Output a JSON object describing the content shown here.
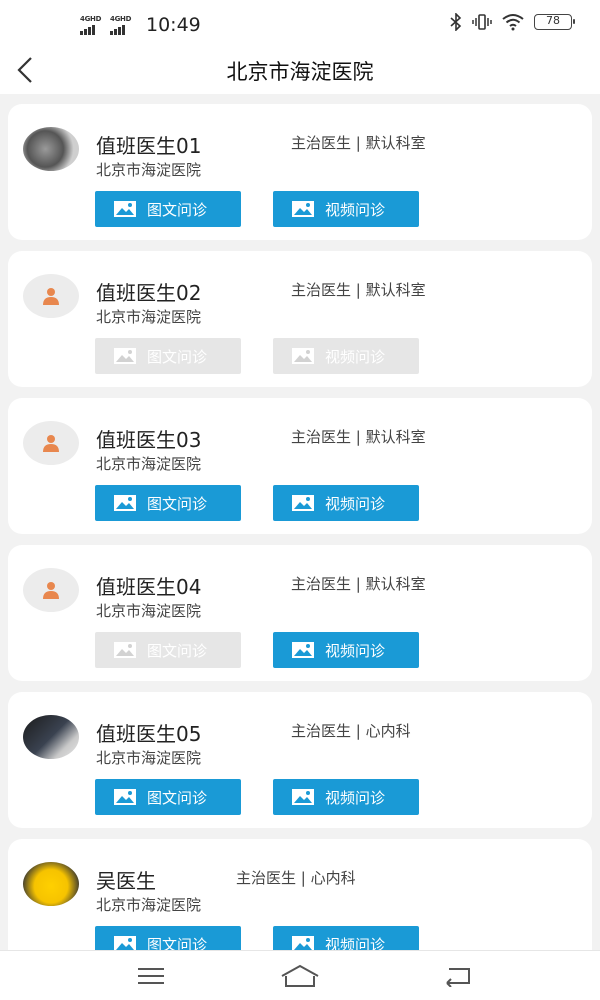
{
  "status_bar": {
    "network_1": "4GHD",
    "network_2": "4GHD",
    "time": "10:49",
    "battery": "78",
    "icons": [
      "bluetooth-icon",
      "vibrate-icon",
      "wifi-icon",
      "battery-icon"
    ]
  },
  "header": {
    "title": "北京市海淀医院",
    "back_icon": "chevron-left-icon"
  },
  "buttons": {
    "text_consult": "图文问诊",
    "video_consult": "视频问诊",
    "icon": "image-icon"
  },
  "doctors": [
    {
      "name": "值班医生01",
      "hospital": "北京市海淀医院",
      "title_dept": "主治医生 | 默认科室",
      "avatar": "photo",
      "text_enabled": true,
      "video_enabled": true
    },
    {
      "name": "值班医生02",
      "hospital": "北京市海淀医院",
      "title_dept": "主治医生 | 默认科室",
      "avatar": "default-person-icon",
      "text_enabled": false,
      "video_enabled": false
    },
    {
      "name": "值班医生03",
      "hospital": "北京市海淀医院",
      "title_dept": "主治医生 | 默认科室",
      "avatar": "default-person-icon",
      "text_enabled": true,
      "video_enabled": true
    },
    {
      "name": "值班医生04",
      "hospital": "北京市海淀医院",
      "title_dept": "主治医生 | 默认科室",
      "avatar": "default-person-icon",
      "text_enabled": false,
      "video_enabled": true
    },
    {
      "name": "值班医生05",
      "hospital": "北京市海淀医院",
      "title_dept": "主治医生 | 心内科",
      "avatar": "photo",
      "text_enabled": true,
      "video_enabled": true
    },
    {
      "name": "吴医生",
      "hospital": "北京市海淀医院",
      "title_dept": "主治医生 | 心内科",
      "avatar": "photo",
      "text_enabled": true,
      "video_enabled": true
    }
  ],
  "nav_bar": {
    "icons": [
      "menu-icon",
      "home-icon",
      "back-icon"
    ]
  },
  "colors": {
    "accent": "#1a9ad6",
    "disabled": "#e6e6e6",
    "background": "#f2f2f2",
    "avatar_person": "#e8874e"
  }
}
